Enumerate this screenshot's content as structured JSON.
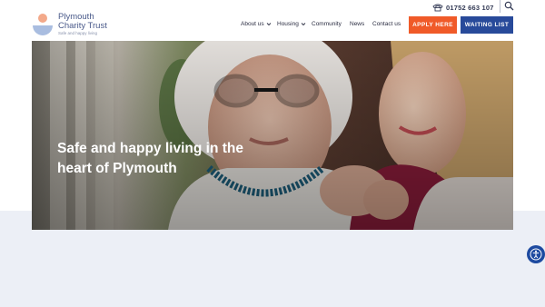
{
  "brand": {
    "name_line1": "Plymouth",
    "name_line2": "Charity Trust",
    "tagline": "Safe and happy living",
    "logo_colors": {
      "dot": "#f3a98a",
      "cup": "#a9bde0"
    }
  },
  "contact": {
    "phone": "01752 663 107",
    "phone_icon": "phone-icon",
    "search_icon": "search-icon"
  },
  "nav": {
    "items": [
      {
        "label": "About us",
        "has_dropdown": true
      },
      {
        "label": "Housing",
        "has_dropdown": true
      },
      {
        "label": "Community",
        "has_dropdown": false
      },
      {
        "label": "News",
        "has_dropdown": false
      },
      {
        "label": "Contact us",
        "has_dropdown": false
      }
    ],
    "apply_label": "APPLY HERE",
    "waiting_label": "WAITING LIST"
  },
  "hero": {
    "heading": "Safe and happy living in the heart of Plymouth"
  },
  "colors": {
    "accent_orange": "#f05a28",
    "accent_blue": "#284a9a",
    "band": "#eceff6"
  },
  "accessibility": {
    "icon": "accessibility-icon"
  }
}
